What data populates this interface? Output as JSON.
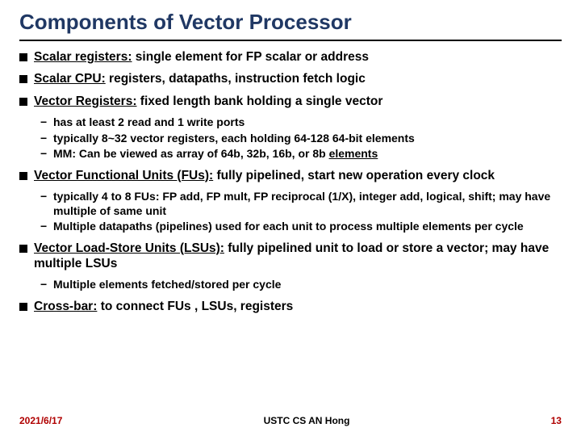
{
  "title": "Components of Vector Processor",
  "items": [
    {
      "label": "Scalar registers:",
      "rest": " single element for FP scalar or address",
      "subs": []
    },
    {
      "label": "Scalar CPU:",
      "rest": " registers, datapaths, instruction fetch logic",
      "subs": []
    },
    {
      "label": "Vector Registers:",
      "rest": " fixed length bank holding a single vector",
      "subs": [
        {
          "t": "has at least 2 read and 1 write ports"
        },
        {
          "t": "typically 8~32 vector registers, each holding 64-128 64-bit elements"
        },
        {
          "t": "MM: Can be viewed as array of 64b, 32b, 16b, or 8b ",
          "tail_under": "elements"
        }
      ]
    },
    {
      "label": "Vector Functional Units (FUs):",
      "rest": " fully pipelined, start new operation every clock",
      "subs": [
        {
          "t": "typically 4 to 8 FUs: FP add, FP mult, FP reciprocal (1/X), integer add, logical, shift; may have multiple of same unit"
        },
        {
          "t": "Multiple datapaths (pipelines) used for each unit to process multiple elements per cycle"
        }
      ]
    },
    {
      "label": "Vector Load-Store Units (LSUs):",
      "rest": " fully pipelined unit to load or store a vector; may have multiple LSUs",
      "subs": [
        {
          "t": "Multiple elements fetched/stored per cycle"
        }
      ]
    },
    {
      "label": "Cross-bar:",
      "rest": "  to connect FUs , LSUs, registers",
      "subs": []
    }
  ],
  "footer": {
    "date": "2021/6/17",
    "center": "USTC CS AN Hong",
    "page": "13"
  }
}
